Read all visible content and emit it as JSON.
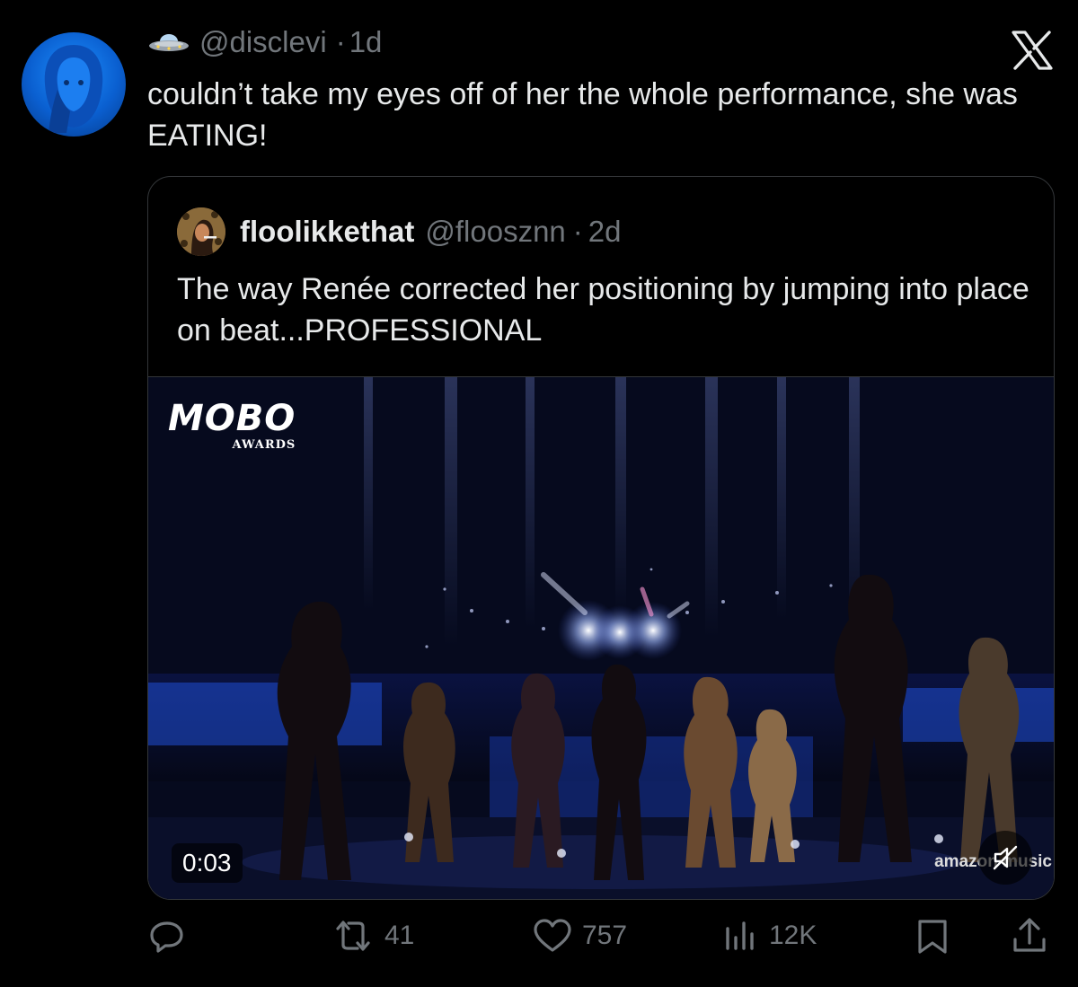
{
  "post": {
    "handle": "@disclevi",
    "time_separator": "·",
    "time": "1d",
    "text": "couldn’t take my eyes off of her the whole performance, she was EATING!",
    "avatar_icon": "avatar-icon",
    "badge_icon": "ufo-icon"
  },
  "quoted_post": {
    "display_name": "floolikkethat",
    "handle": "@floosznn",
    "time_separator": "·",
    "time": "2d",
    "text": "The way Renée corrected her positioning by jumping into place on beat...PROFESSIONAL",
    "video": {
      "logo_word": "MOBO",
      "logo_sub": "AWARDS",
      "timestamp": "0:03",
      "watermark": "amazon music"
    }
  },
  "actions": {
    "reply": {
      "icon": "reply-icon",
      "count": ""
    },
    "repost": {
      "icon": "repost-icon",
      "count": "41"
    },
    "like": {
      "icon": "heart-icon",
      "count": "757"
    },
    "views": {
      "icon": "views-icon",
      "count": "12K"
    },
    "bookmark": {
      "icon": "bookmark-icon"
    },
    "share": {
      "icon": "share-icon"
    }
  },
  "colors": {
    "background": "#000000",
    "text_primary": "#e7e9ea",
    "text_secondary": "#71767b",
    "border": "#333639"
  }
}
